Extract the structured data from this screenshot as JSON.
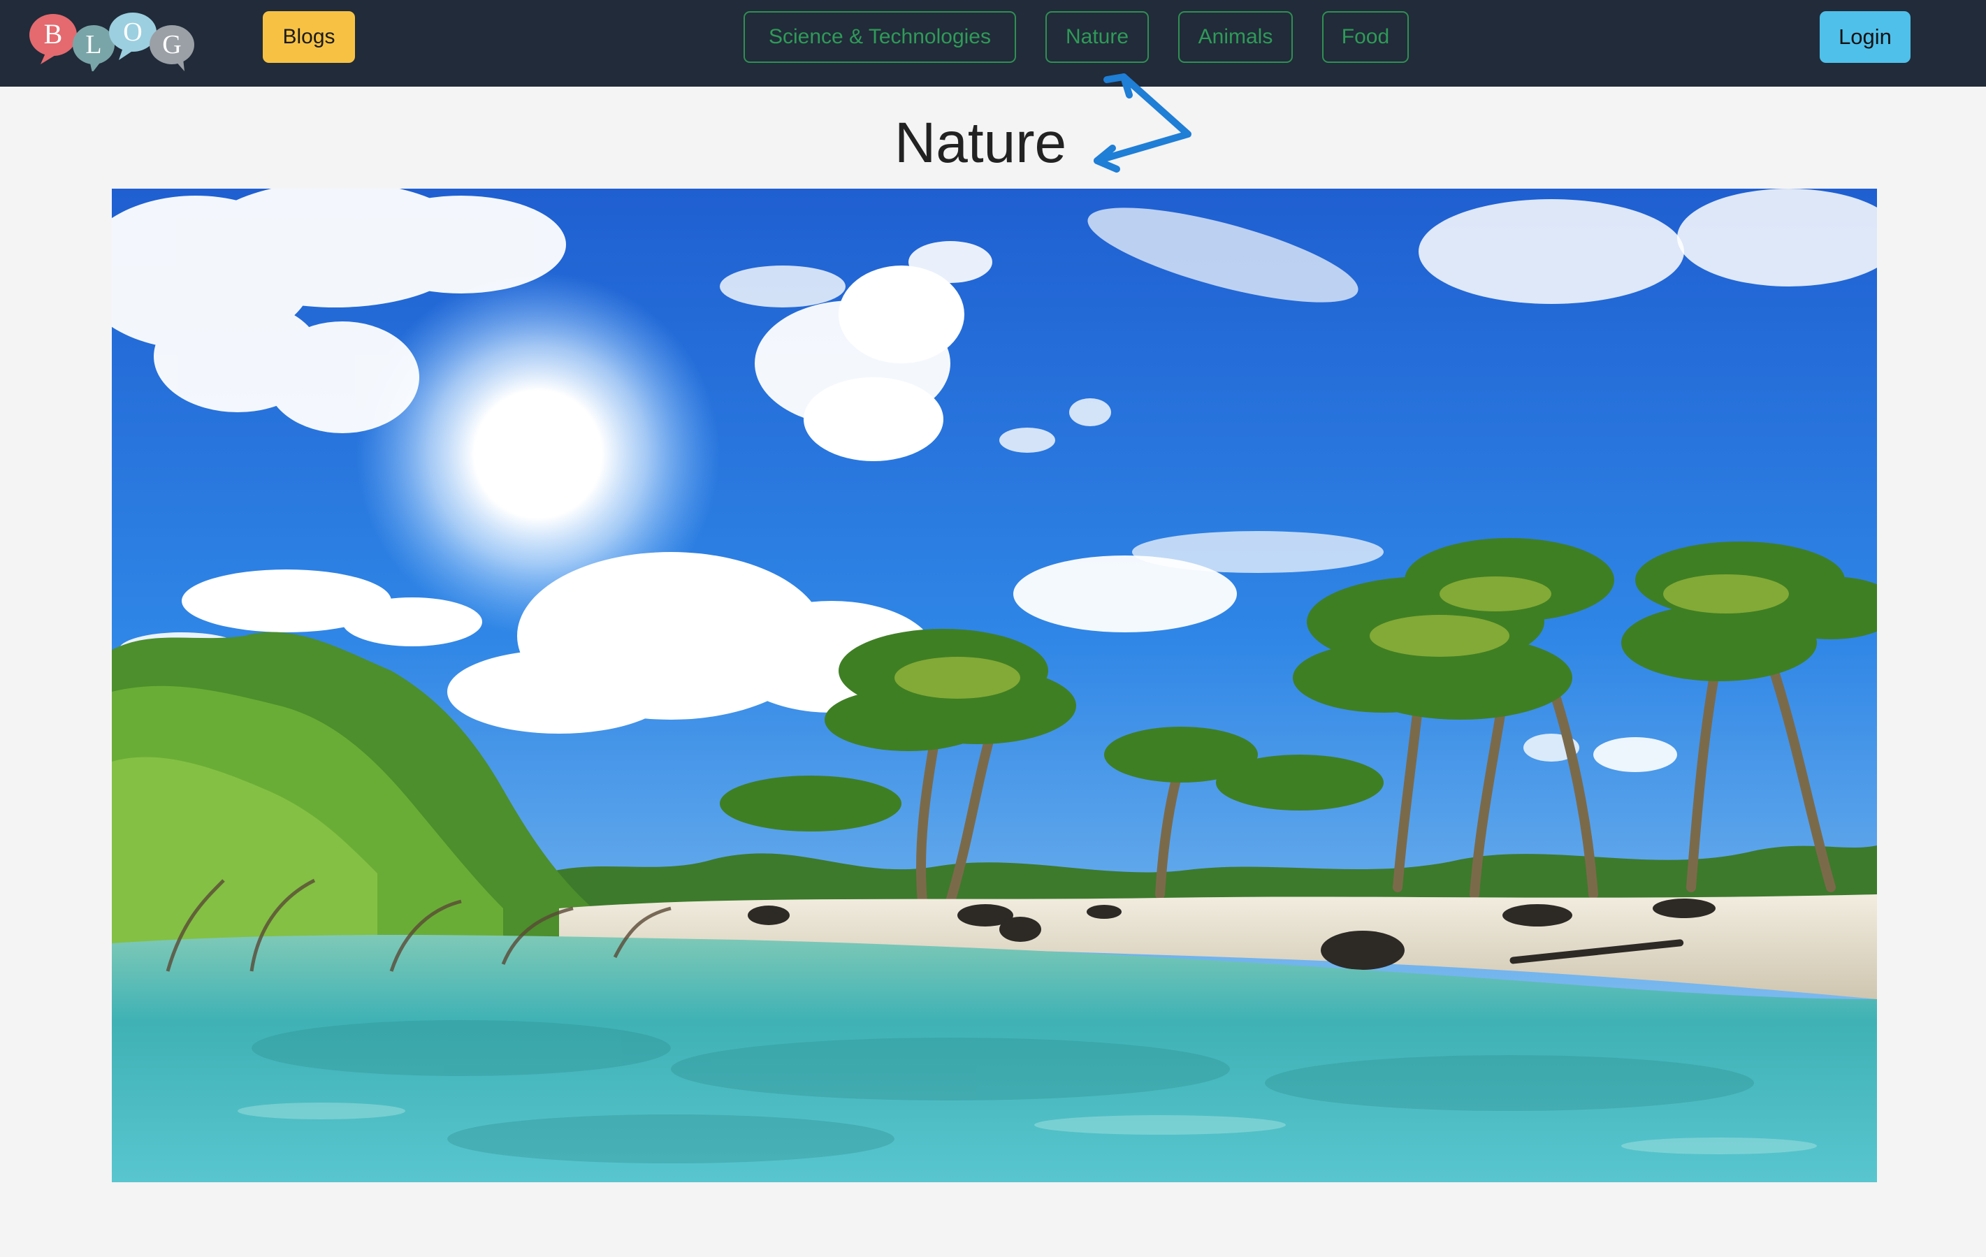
{
  "navbar": {
    "logo_letters": [
      "B",
      "L",
      "O",
      "G"
    ],
    "blogs_label": "Blogs",
    "categories": [
      {
        "label": "Science & Technologies"
      },
      {
        "label": "Nature"
      },
      {
        "label": "Animals"
      },
      {
        "label": "Food"
      }
    ],
    "login_label": "Login"
  },
  "main": {
    "title": "Nature",
    "hero_image": "tropical-beach-palm-trees-photo"
  },
  "colors": {
    "navbar_bg": "#212b39",
    "blogs_btn": "#f7c244",
    "category_outline": "#2f8f53",
    "login_btn": "#4fc0ea",
    "annotation_arrow": "#1f7ed6",
    "page_bg": "#f4f4f4"
  }
}
